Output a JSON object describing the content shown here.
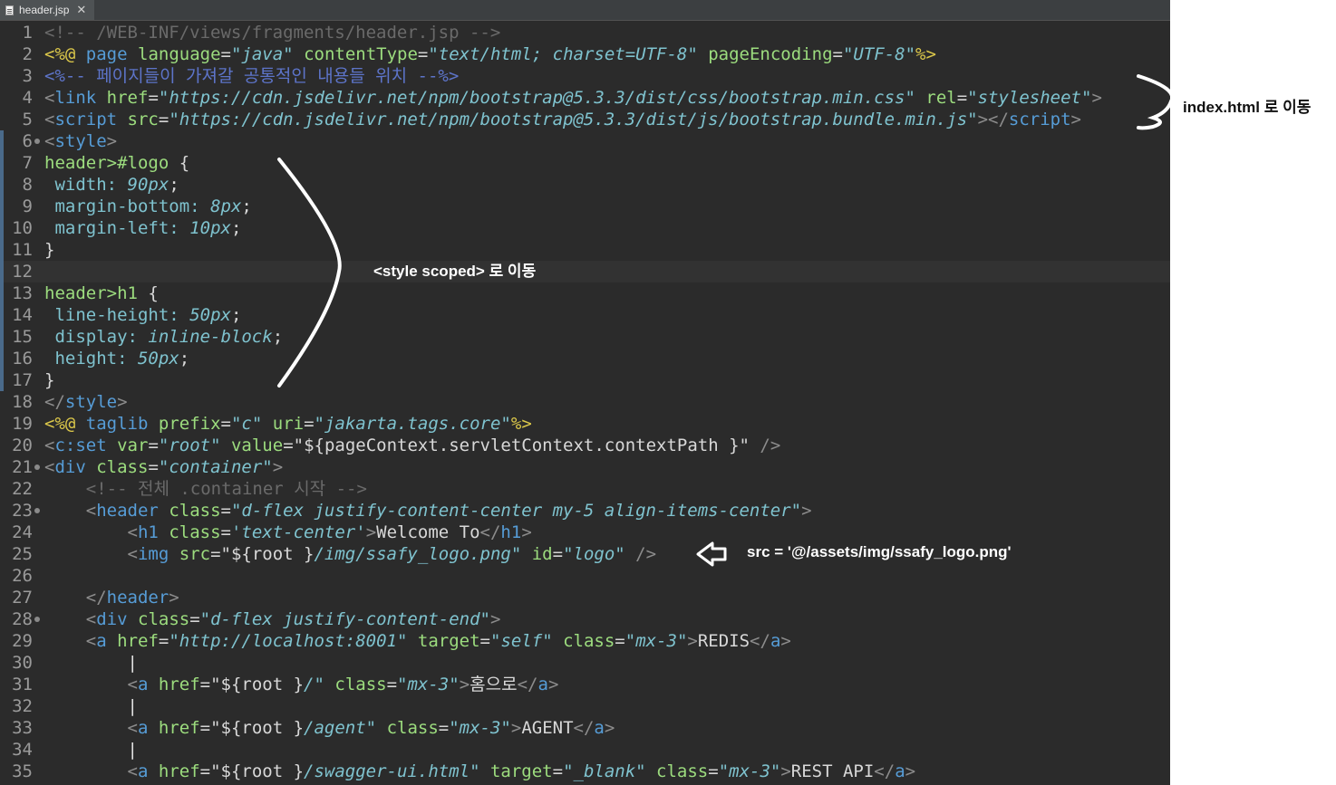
{
  "tab": {
    "filename": "header.jsp",
    "close_glyph": "✕",
    "file_icon": "jsp-file-icon"
  },
  "code_lines": [
    {
      "n": "1",
      "segs": [
        [
          "cmt",
          "<!-- /WEB-INF/views/fragments/header.jsp -->"
        ]
      ]
    },
    {
      "n": "2",
      "segs": [
        [
          "jsp",
          "<%@"
        ],
        [
          "txt",
          " "
        ],
        [
          "tag",
          "page"
        ],
        [
          "txt",
          " "
        ],
        [
          "attr",
          "language"
        ],
        [
          "eq",
          "="
        ],
        [
          "str",
          "\"java\""
        ],
        [
          "txt",
          " "
        ],
        [
          "attr",
          "contentType"
        ],
        [
          "eq",
          "="
        ],
        [
          "str",
          "\"text/html; charset=UTF-8\""
        ],
        [
          "txt",
          " "
        ],
        [
          "attr",
          "pageEncoding"
        ],
        [
          "eq",
          "="
        ],
        [
          "str",
          "\"UTF-8\""
        ],
        [
          "jsp",
          "%>"
        ]
      ]
    },
    {
      "n": "3",
      "segs": [
        [
          "jcmt",
          "<%-- 페이지들이 가져갈 공통적인 내용들 위치 --%>"
        ]
      ]
    },
    {
      "n": "4",
      "segs": [
        [
          "br",
          "<"
        ],
        [
          "tag",
          "link"
        ],
        [
          "txt",
          " "
        ],
        [
          "attr",
          "href"
        ],
        [
          "eq",
          "="
        ],
        [
          "str",
          "\"https://cdn.jsdelivr.net/npm/bootstrap@5.3.3/dist/css/bootstrap.min.css\""
        ],
        [
          "txt",
          " "
        ],
        [
          "attr",
          "rel"
        ],
        [
          "eq",
          "="
        ],
        [
          "str",
          "\"stylesheet\""
        ],
        [
          "br",
          ">"
        ]
      ]
    },
    {
      "n": "5",
      "segs": [
        [
          "br",
          "<"
        ],
        [
          "tag",
          "script"
        ],
        [
          "txt",
          " "
        ],
        [
          "attr",
          "src"
        ],
        [
          "eq",
          "="
        ],
        [
          "str",
          "\"https://cdn.jsdelivr.net/npm/bootstrap@5.3.3/dist/js/bootstrap.bundle.min.js\""
        ],
        [
          "br",
          "></"
        ],
        [
          "tag",
          "script"
        ],
        [
          "br",
          ">"
        ]
      ]
    },
    {
      "n": "6",
      "fold": true,
      "edge": true,
      "segs": [
        [
          "br",
          "<"
        ],
        [
          "tag",
          "style"
        ],
        [
          "br",
          ">"
        ]
      ]
    },
    {
      "n": "7",
      "edge": true,
      "segs": [
        [
          "sel",
          "header>#logo"
        ],
        [
          "txt",
          " {"
        ]
      ]
    },
    {
      "n": "8",
      "edge": true,
      "segs": [
        [
          "txt",
          " "
        ],
        [
          "prop",
          "width:"
        ],
        [
          "txt",
          " "
        ],
        [
          "val",
          "90px"
        ],
        [
          "txt",
          ";"
        ]
      ]
    },
    {
      "n": "9",
      "edge": true,
      "segs": [
        [
          "txt",
          " "
        ],
        [
          "prop",
          "margin-bottom:"
        ],
        [
          "txt",
          " "
        ],
        [
          "val",
          "8px"
        ],
        [
          "txt",
          ";"
        ]
      ]
    },
    {
      "n": "10",
      "edge": true,
      "segs": [
        [
          "txt",
          " "
        ],
        [
          "prop",
          "margin-left:"
        ],
        [
          "txt",
          " "
        ],
        [
          "val",
          "10px"
        ],
        [
          "txt",
          ";"
        ]
      ]
    },
    {
      "n": "11",
      "edge": true,
      "segs": [
        [
          "txt",
          "}"
        ]
      ]
    },
    {
      "n": "12",
      "edge": true,
      "current": true,
      "segs": []
    },
    {
      "n": "13",
      "edge": true,
      "segs": [
        [
          "sel",
          "header>h1"
        ],
        [
          "txt",
          " {"
        ]
      ]
    },
    {
      "n": "14",
      "edge": true,
      "segs": [
        [
          "txt",
          " "
        ],
        [
          "prop",
          "line-height:"
        ],
        [
          "txt",
          " "
        ],
        [
          "val",
          "50px"
        ],
        [
          "txt",
          ";"
        ]
      ]
    },
    {
      "n": "15",
      "edge": true,
      "segs": [
        [
          "txt",
          " "
        ],
        [
          "prop",
          "display:"
        ],
        [
          "txt",
          " "
        ],
        [
          "val",
          "inline-block"
        ],
        [
          "txt",
          ";"
        ]
      ]
    },
    {
      "n": "16",
      "edge": true,
      "segs": [
        [
          "txt",
          " "
        ],
        [
          "prop",
          "height:"
        ],
        [
          "txt",
          " "
        ],
        [
          "val",
          "50px"
        ],
        [
          "txt",
          ";"
        ]
      ]
    },
    {
      "n": "17",
      "edge": true,
      "segs": [
        [
          "txt",
          "}"
        ]
      ]
    },
    {
      "n": "18",
      "segs": [
        [
          "br",
          "</"
        ],
        [
          "tag",
          "style"
        ],
        [
          "br",
          ">"
        ]
      ]
    },
    {
      "n": "19",
      "segs": [
        [
          "jsp",
          "<%@"
        ],
        [
          "txt",
          " "
        ],
        [
          "tag",
          "taglib"
        ],
        [
          "txt",
          " "
        ],
        [
          "attr",
          "prefix"
        ],
        [
          "eq",
          "="
        ],
        [
          "str",
          "\"c\""
        ],
        [
          "txt",
          " "
        ],
        [
          "attr",
          "uri"
        ],
        [
          "eq",
          "="
        ],
        [
          "str",
          "\"jakarta.tags.core\""
        ],
        [
          "jsp",
          "%>"
        ]
      ]
    },
    {
      "n": "20",
      "segs": [
        [
          "br",
          "<"
        ],
        [
          "tag",
          "c:set"
        ],
        [
          "txt",
          " "
        ],
        [
          "attr",
          "var"
        ],
        [
          "eq",
          "="
        ],
        [
          "str",
          "\"root\""
        ],
        [
          "txt",
          " "
        ],
        [
          "attr",
          "value"
        ],
        [
          "eq",
          "="
        ],
        [
          "txt",
          "\"${pageContext.servletContext.contextPath }\""
        ],
        [
          "txt",
          " "
        ],
        [
          "br",
          "/>"
        ]
      ]
    },
    {
      "n": "21",
      "fold": true,
      "segs": [
        [
          "br",
          "<"
        ],
        [
          "tag",
          "div"
        ],
        [
          "txt",
          " "
        ],
        [
          "attr",
          "class"
        ],
        [
          "eq",
          "="
        ],
        [
          "str",
          "\"container\""
        ],
        [
          "br",
          ">"
        ]
      ]
    },
    {
      "n": "22",
      "segs": [
        [
          "txt",
          "    "
        ],
        [
          "cmt",
          "<!-- 전체 .container 시작 -->"
        ]
      ]
    },
    {
      "n": "23",
      "fold": true,
      "segs": [
        [
          "txt",
          "    "
        ],
        [
          "br",
          "<"
        ],
        [
          "tag",
          "header"
        ],
        [
          "txt",
          " "
        ],
        [
          "attr",
          "class"
        ],
        [
          "eq",
          "="
        ],
        [
          "str",
          "\"d-flex justify-content-center my-5 align-items-center\""
        ],
        [
          "br",
          ">"
        ]
      ]
    },
    {
      "n": "24",
      "segs": [
        [
          "txt",
          "        "
        ],
        [
          "br",
          "<"
        ],
        [
          "tag",
          "h1"
        ],
        [
          "txt",
          " "
        ],
        [
          "attr",
          "class"
        ],
        [
          "eq",
          "="
        ],
        [
          "str",
          "'text-center'"
        ],
        [
          "br",
          ">"
        ],
        [
          "txt",
          "Welcome To"
        ],
        [
          "br",
          "</"
        ],
        [
          "tag",
          "h1"
        ],
        [
          "br",
          ">"
        ]
      ]
    },
    {
      "n": "25",
      "segs": [
        [
          "txt",
          "        "
        ],
        [
          "br",
          "<"
        ],
        [
          "tag",
          "img"
        ],
        [
          "txt",
          " "
        ],
        [
          "attr",
          "src"
        ],
        [
          "eq",
          "="
        ],
        [
          "txt",
          "\"${root }"
        ],
        [
          "str",
          "/img/ssafy_logo.png\""
        ],
        [
          "txt",
          " "
        ],
        [
          "attr",
          "id"
        ],
        [
          "eq",
          "="
        ],
        [
          "str",
          "\"logo\""
        ],
        [
          "txt",
          " "
        ],
        [
          "br",
          "/>"
        ]
      ]
    },
    {
      "n": "26",
      "segs": []
    },
    {
      "n": "27",
      "segs": [
        [
          "txt",
          "    "
        ],
        [
          "br",
          "</"
        ],
        [
          "tag",
          "header"
        ],
        [
          "br",
          ">"
        ]
      ]
    },
    {
      "n": "28",
      "fold": true,
      "segs": [
        [
          "txt",
          "    "
        ],
        [
          "br",
          "<"
        ],
        [
          "tag",
          "div"
        ],
        [
          "txt",
          " "
        ],
        [
          "attr",
          "class"
        ],
        [
          "eq",
          "="
        ],
        [
          "str",
          "\"d-flex justify-content-end\""
        ],
        [
          "br",
          ">"
        ]
      ]
    },
    {
      "n": "29",
      "segs": [
        [
          "txt",
          "    "
        ],
        [
          "br",
          "<"
        ],
        [
          "tag",
          "a"
        ],
        [
          "txt",
          " "
        ],
        [
          "attr",
          "href"
        ],
        [
          "eq",
          "="
        ],
        [
          "str",
          "\"http://localhost:8001\""
        ],
        [
          "txt",
          " "
        ],
        [
          "attr",
          "target"
        ],
        [
          "eq",
          "="
        ],
        [
          "str",
          "\"self\""
        ],
        [
          "txt",
          " "
        ],
        [
          "attr",
          "class"
        ],
        [
          "eq",
          "="
        ],
        [
          "str",
          "\"mx-3\""
        ],
        [
          "br",
          ">"
        ],
        [
          "txt",
          "REDIS"
        ],
        [
          "br",
          "</"
        ],
        [
          "tag",
          "a"
        ],
        [
          "br",
          ">"
        ]
      ]
    },
    {
      "n": "30",
      "segs": [
        [
          "txt",
          "        "
        ],
        [
          "pipe",
          "|"
        ]
      ]
    },
    {
      "n": "31",
      "segs": [
        [
          "txt",
          "        "
        ],
        [
          "br",
          "<"
        ],
        [
          "tag",
          "a"
        ],
        [
          "txt",
          " "
        ],
        [
          "attr",
          "href"
        ],
        [
          "eq",
          "="
        ],
        [
          "txt",
          "\"${root }"
        ],
        [
          "str",
          "/\""
        ],
        [
          "txt",
          " "
        ],
        [
          "attr",
          "class"
        ],
        [
          "eq",
          "="
        ],
        [
          "str",
          "\"mx-3\""
        ],
        [
          "br",
          ">"
        ],
        [
          "txt",
          "홈으로"
        ],
        [
          "br",
          "</"
        ],
        [
          "tag",
          "a"
        ],
        [
          "br",
          ">"
        ]
      ]
    },
    {
      "n": "32",
      "segs": [
        [
          "txt",
          "        "
        ],
        [
          "pipe",
          "|"
        ]
      ]
    },
    {
      "n": "33",
      "segs": [
        [
          "txt",
          "        "
        ],
        [
          "br",
          "<"
        ],
        [
          "tag",
          "a"
        ],
        [
          "txt",
          " "
        ],
        [
          "attr",
          "href"
        ],
        [
          "eq",
          "="
        ],
        [
          "txt",
          "\"${root }"
        ],
        [
          "str",
          "/agent\""
        ],
        [
          "txt",
          " "
        ],
        [
          "attr",
          "class"
        ],
        [
          "eq",
          "="
        ],
        [
          "str",
          "\"mx-3\""
        ],
        [
          "br",
          ">"
        ],
        [
          "txt",
          "AGENT"
        ],
        [
          "br",
          "</"
        ],
        [
          "tag",
          "a"
        ],
        [
          "br",
          ">"
        ]
      ]
    },
    {
      "n": "34",
      "segs": [
        [
          "txt",
          "        "
        ],
        [
          "pipe",
          "|"
        ]
      ]
    },
    {
      "n": "35",
      "segs": [
        [
          "txt",
          "        "
        ],
        [
          "br",
          "<"
        ],
        [
          "tag",
          "a"
        ],
        [
          "txt",
          " "
        ],
        [
          "attr",
          "href"
        ],
        [
          "eq",
          "="
        ],
        [
          "txt",
          "\"${root }"
        ],
        [
          "str",
          "/swagger-ui.html\""
        ],
        [
          "txt",
          " "
        ],
        [
          "attr",
          "target"
        ],
        [
          "eq",
          "="
        ],
        [
          "str",
          "\"_blank\""
        ],
        [
          "txt",
          " "
        ],
        [
          "attr",
          "class"
        ],
        [
          "eq",
          "="
        ],
        [
          "str",
          "\"mx-3\""
        ],
        [
          "br",
          ">"
        ],
        [
          "txt",
          "REST API"
        ],
        [
          "br",
          "</"
        ],
        [
          "tag",
          "a"
        ],
        [
          "br",
          ">"
        ]
      ]
    }
  ],
  "annotations": {
    "move_to_index": "index.html 로 이동",
    "move_to_style_scoped": "<style scoped> 로 이동",
    "src_replacement": "src = '@/assets/img/ssafy_logo.png'"
  }
}
